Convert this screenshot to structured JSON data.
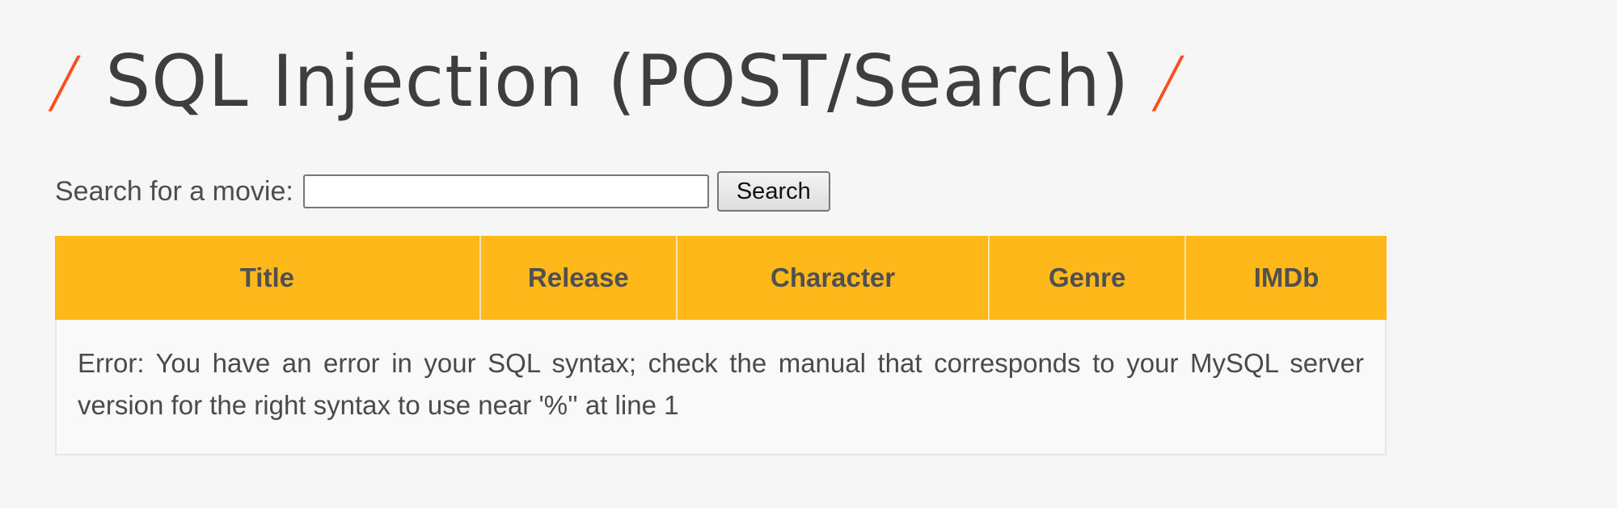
{
  "header": {
    "title": "SQL Injection (POST/Search)",
    "left_mark": "/",
    "right_mark": "/"
  },
  "search": {
    "label": "Search for a movie:",
    "value": "",
    "placeholder": "",
    "button_label": "Search"
  },
  "table": {
    "columns": [
      "Title",
      "Release",
      "Character",
      "Genre",
      "IMDb"
    ],
    "error_message": "Error: You have an error in your SQL syntax; check the manual that corresponds to your MySQL server version for the right syntax to use near '%'' at line 1"
  },
  "colors": {
    "accent": "#ff4d1f",
    "table_header": "#ffb81a",
    "background": "#f6f6f6"
  },
  "icons": {
    "header_marks": "slash"
  }
}
